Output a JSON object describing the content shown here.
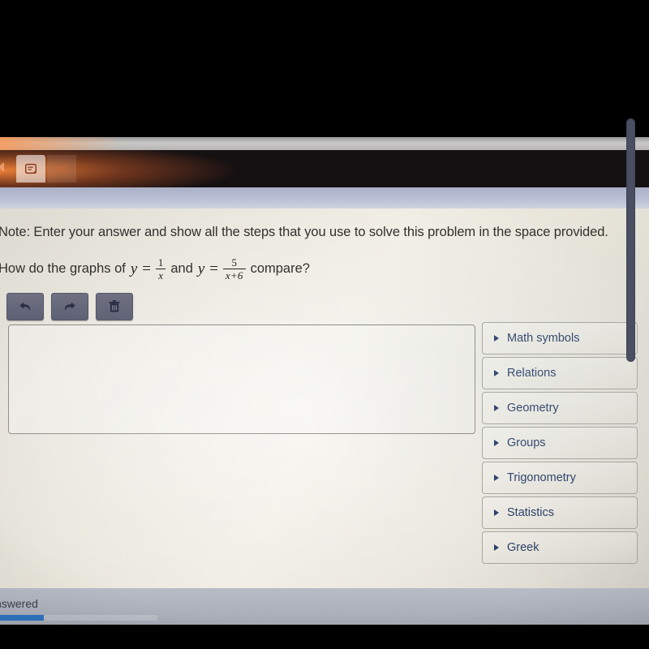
{
  "browser": {
    "tab_icon": "note-tab-icon",
    "close_icon": "close-icon",
    "back_arrow_icon": "back-arrow-icon"
  },
  "question": {
    "note": "Note: Enter your answer and show all the steps that you use to solve this problem in the space provided.",
    "prompt_prefix": "How do the graphs of",
    "equation_1": {
      "lhs": "y =",
      "numerator": "1",
      "denominator": "x"
    },
    "conjunction": "and",
    "equation_2": {
      "lhs": "y =",
      "numerator": "5",
      "denominator": "x+6"
    },
    "prompt_suffix": "compare?"
  },
  "toolbar": {
    "buttons": [
      {
        "name": "undo-button",
        "icon": "undo-arrow-icon",
        "label": "Undo"
      },
      {
        "name": "redo-button",
        "icon": "redo-arrow-icon",
        "label": "Redo"
      },
      {
        "name": "delete-button",
        "icon": "trash-icon",
        "label": "Delete"
      }
    ]
  },
  "answer_area": {
    "value": "",
    "placeholder": ""
  },
  "palette": {
    "items": [
      {
        "label": "Math symbols"
      },
      {
        "label": "Relations"
      },
      {
        "label": "Geometry"
      },
      {
        "label": "Groups"
      },
      {
        "label": "Trigonometry"
      },
      {
        "label": "Statistics"
      },
      {
        "label": "Greek"
      }
    ]
  },
  "status": {
    "text": "nswered",
    "progress_percent": 30
  },
  "colors": {
    "accent_blue": "#2f74c0",
    "palette_text": "#2e4269",
    "toolbar_button": "#6f7183",
    "page_background": "#e7e4da"
  }
}
